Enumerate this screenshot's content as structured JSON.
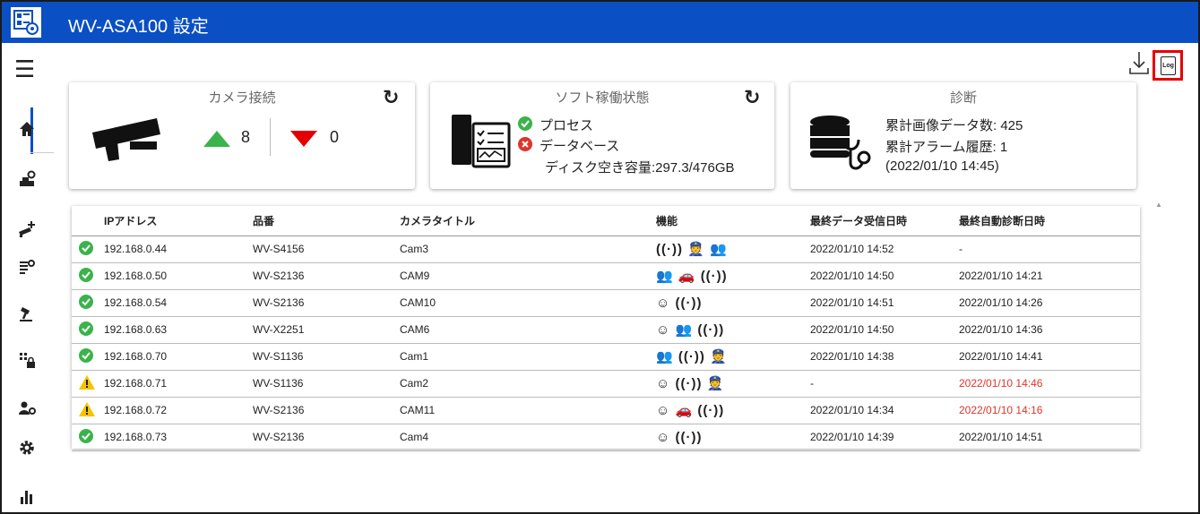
{
  "app": {
    "title": "WV-ASA100 設定",
    "accent_color": "#0a4fc4",
    "alarm_color": "#e0342a",
    "ok_color": "#3bb34a",
    "warn_color": "#f5c400"
  },
  "toolbar": {
    "menu_icon": "hamburger-icon",
    "download_icon": "download-icon",
    "log_label": "Log"
  },
  "sidebar": {
    "items": [
      {
        "name": "home",
        "icon": "home-icon"
      },
      {
        "name": "camera-settings",
        "icon": "camera-gear-icon"
      },
      {
        "name": "camera-add",
        "icon": "camera-add-icon"
      },
      {
        "name": "list-settings",
        "icon": "list-gear-icon"
      },
      {
        "name": "tool",
        "icon": "hammer-icon"
      },
      {
        "name": "grid-lock",
        "icon": "grid-lock-icon"
      },
      {
        "name": "user-settings",
        "icon": "user-gear-icon"
      },
      {
        "name": "settings",
        "icon": "gear-icon"
      },
      {
        "name": "statistics",
        "icon": "bar-chart-icon"
      }
    ]
  },
  "cards": {
    "camera": {
      "title": "カメラ接続",
      "up_count": "8",
      "down_count": "0"
    },
    "software": {
      "title": "ソフト稼働状態",
      "process_label": "プロセス",
      "database_label": "データベース",
      "disk_label": "ディスク空き容量:297.3/476GB"
    },
    "diagnosis": {
      "title": "診断",
      "image_count": "累計画像データ数: 425",
      "alarm_history": "累計アラーム履歴: 1",
      "timestamp": "(2022/01/10 14:45)"
    }
  },
  "table": {
    "headers": [
      "IPアドレス",
      "品番",
      "カメラタイトル",
      "機能",
      "最終データ受信日時",
      "最終自動診断日時"
    ],
    "rows": [
      {
        "status": "ok",
        "ip": "192.168.0.44",
        "model": "WV-S4156",
        "title": "Cam3",
        "functions": "((·)) 👮 👥",
        "received": "2022/01/10 14:52",
        "diagnosed": "-",
        "alarm": false
      },
      {
        "status": "ok",
        "ip": "192.168.0.50",
        "model": "WV-S2136",
        "title": "CAM9",
        "functions": "👥 🚗 ((·))",
        "received": "2022/01/10 14:50",
        "diagnosed": "2022/01/10 14:21",
        "alarm": false
      },
      {
        "status": "ok",
        "ip": "192.168.0.54",
        "model": "WV-S2136",
        "title": "CAM10",
        "functions": "☺ ((·))",
        "received": "2022/01/10 14:51",
        "diagnosed": "2022/01/10 14:26",
        "alarm": false
      },
      {
        "status": "ok",
        "ip": "192.168.0.63",
        "model": "WV-X2251",
        "title": "CAM6",
        "functions": "☺ 👥 ((·))",
        "received": "2022/01/10 14:50",
        "diagnosed": "2022/01/10 14:36",
        "alarm": false
      },
      {
        "status": "ok",
        "ip": "192.168.0.70",
        "model": "WV-S1136",
        "title": "Cam1",
        "functions": "👥 ((·)) 👮",
        "received": "2022/01/10 14:38",
        "diagnosed": "2022/01/10 14:41",
        "alarm": false
      },
      {
        "status": "warn",
        "ip": "192.168.0.71",
        "model": "WV-S1136",
        "title": "Cam2",
        "functions": "☺ ((·)) 👮",
        "received": "-",
        "diagnosed": "2022/01/10 14:46",
        "alarm": true
      },
      {
        "status": "warn",
        "ip": "192.168.0.72",
        "model": "WV-S2136",
        "title": "CAM11",
        "functions": "☺ 🚗 ((·))",
        "received": "2022/01/10 14:34",
        "diagnosed": "2022/01/10 14:16",
        "alarm": true
      },
      {
        "status": "ok",
        "ip": "192.168.0.73",
        "model": "WV-S2136",
        "title": "Cam4",
        "functions": "☺ ((·))",
        "received": "2022/01/10 14:39",
        "diagnosed": "2022/01/10 14:51",
        "alarm": false
      }
    ]
  }
}
